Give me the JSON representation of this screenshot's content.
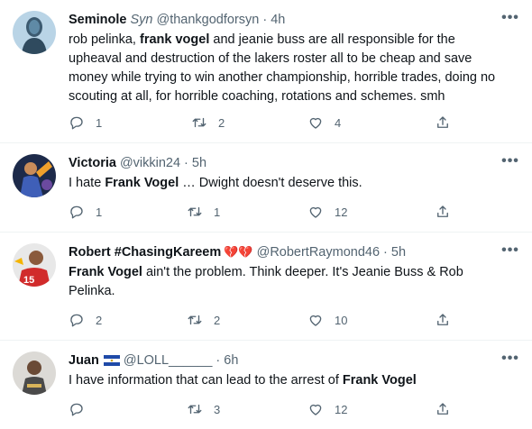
{
  "tweets": [
    {
      "name": "Seminole",
      "name_extra": "Syn",
      "handle": "@thankgodforsyn",
      "dot": "·",
      "time": "4h",
      "body_parts": [
        {
          "text": "rob pelinka, ",
          "bold": false
        },
        {
          "text": "frank vogel",
          "bold": true
        },
        {
          "text": " and jeanie buss are all responsible for the upheaval and destruction of the lakers roster all to be cheap and save money while trying to win another championship, horrible trades, doing no scouting at all, for horrible coaching, rotations and schemes. smh",
          "bold": false
        }
      ],
      "replies": "1",
      "retweets": "2",
      "likes": "4"
    },
    {
      "name": "Victoria",
      "handle": "@vikkin24",
      "dot": "·",
      "time": "5h",
      "body_parts": [
        {
          "text": "I hate ",
          "bold": false
        },
        {
          "text": "Frank Vogel",
          "bold": true
        },
        {
          "text": " … Dwight doesn't deserve this.",
          "bold": false
        }
      ],
      "replies": "1",
      "retweets": "1",
      "likes": "12"
    },
    {
      "name": "Robert #ChasingKareem",
      "name_emoji": "💔💔",
      "handle": "@RobertRaymond46",
      "dot": "·",
      "time": "5h",
      "body_parts": [
        {
          "text": "Frank Vogel",
          "bold": true
        },
        {
          "text": " ain't the problem. Think deeper. It's Jeanie Buss & Rob Pelinka.",
          "bold": false
        }
      ],
      "replies": "2",
      "retweets": "2",
      "likes": "10"
    },
    {
      "name": "Juan",
      "name_emoji": "🇸🇻",
      "handle": "@LOLL______",
      "dot": "·",
      "time": "6h",
      "body_parts": [
        {
          "text": "I have information that can lead to the arrest of ",
          "bold": false
        },
        {
          "text": "Frank Vogel",
          "bold": true
        }
      ],
      "replies": "",
      "retweets": "3",
      "likes": "12"
    }
  ],
  "icons": {
    "more": "more-dots-icon",
    "reply": "reply-icon",
    "retweet": "retweet-icon",
    "like": "heart-icon",
    "share": "share-icon"
  },
  "more_label": "•••",
  "colors": {
    "text": "#0f1419",
    "secondary": "#536471",
    "divider": "#eff3f4"
  }
}
